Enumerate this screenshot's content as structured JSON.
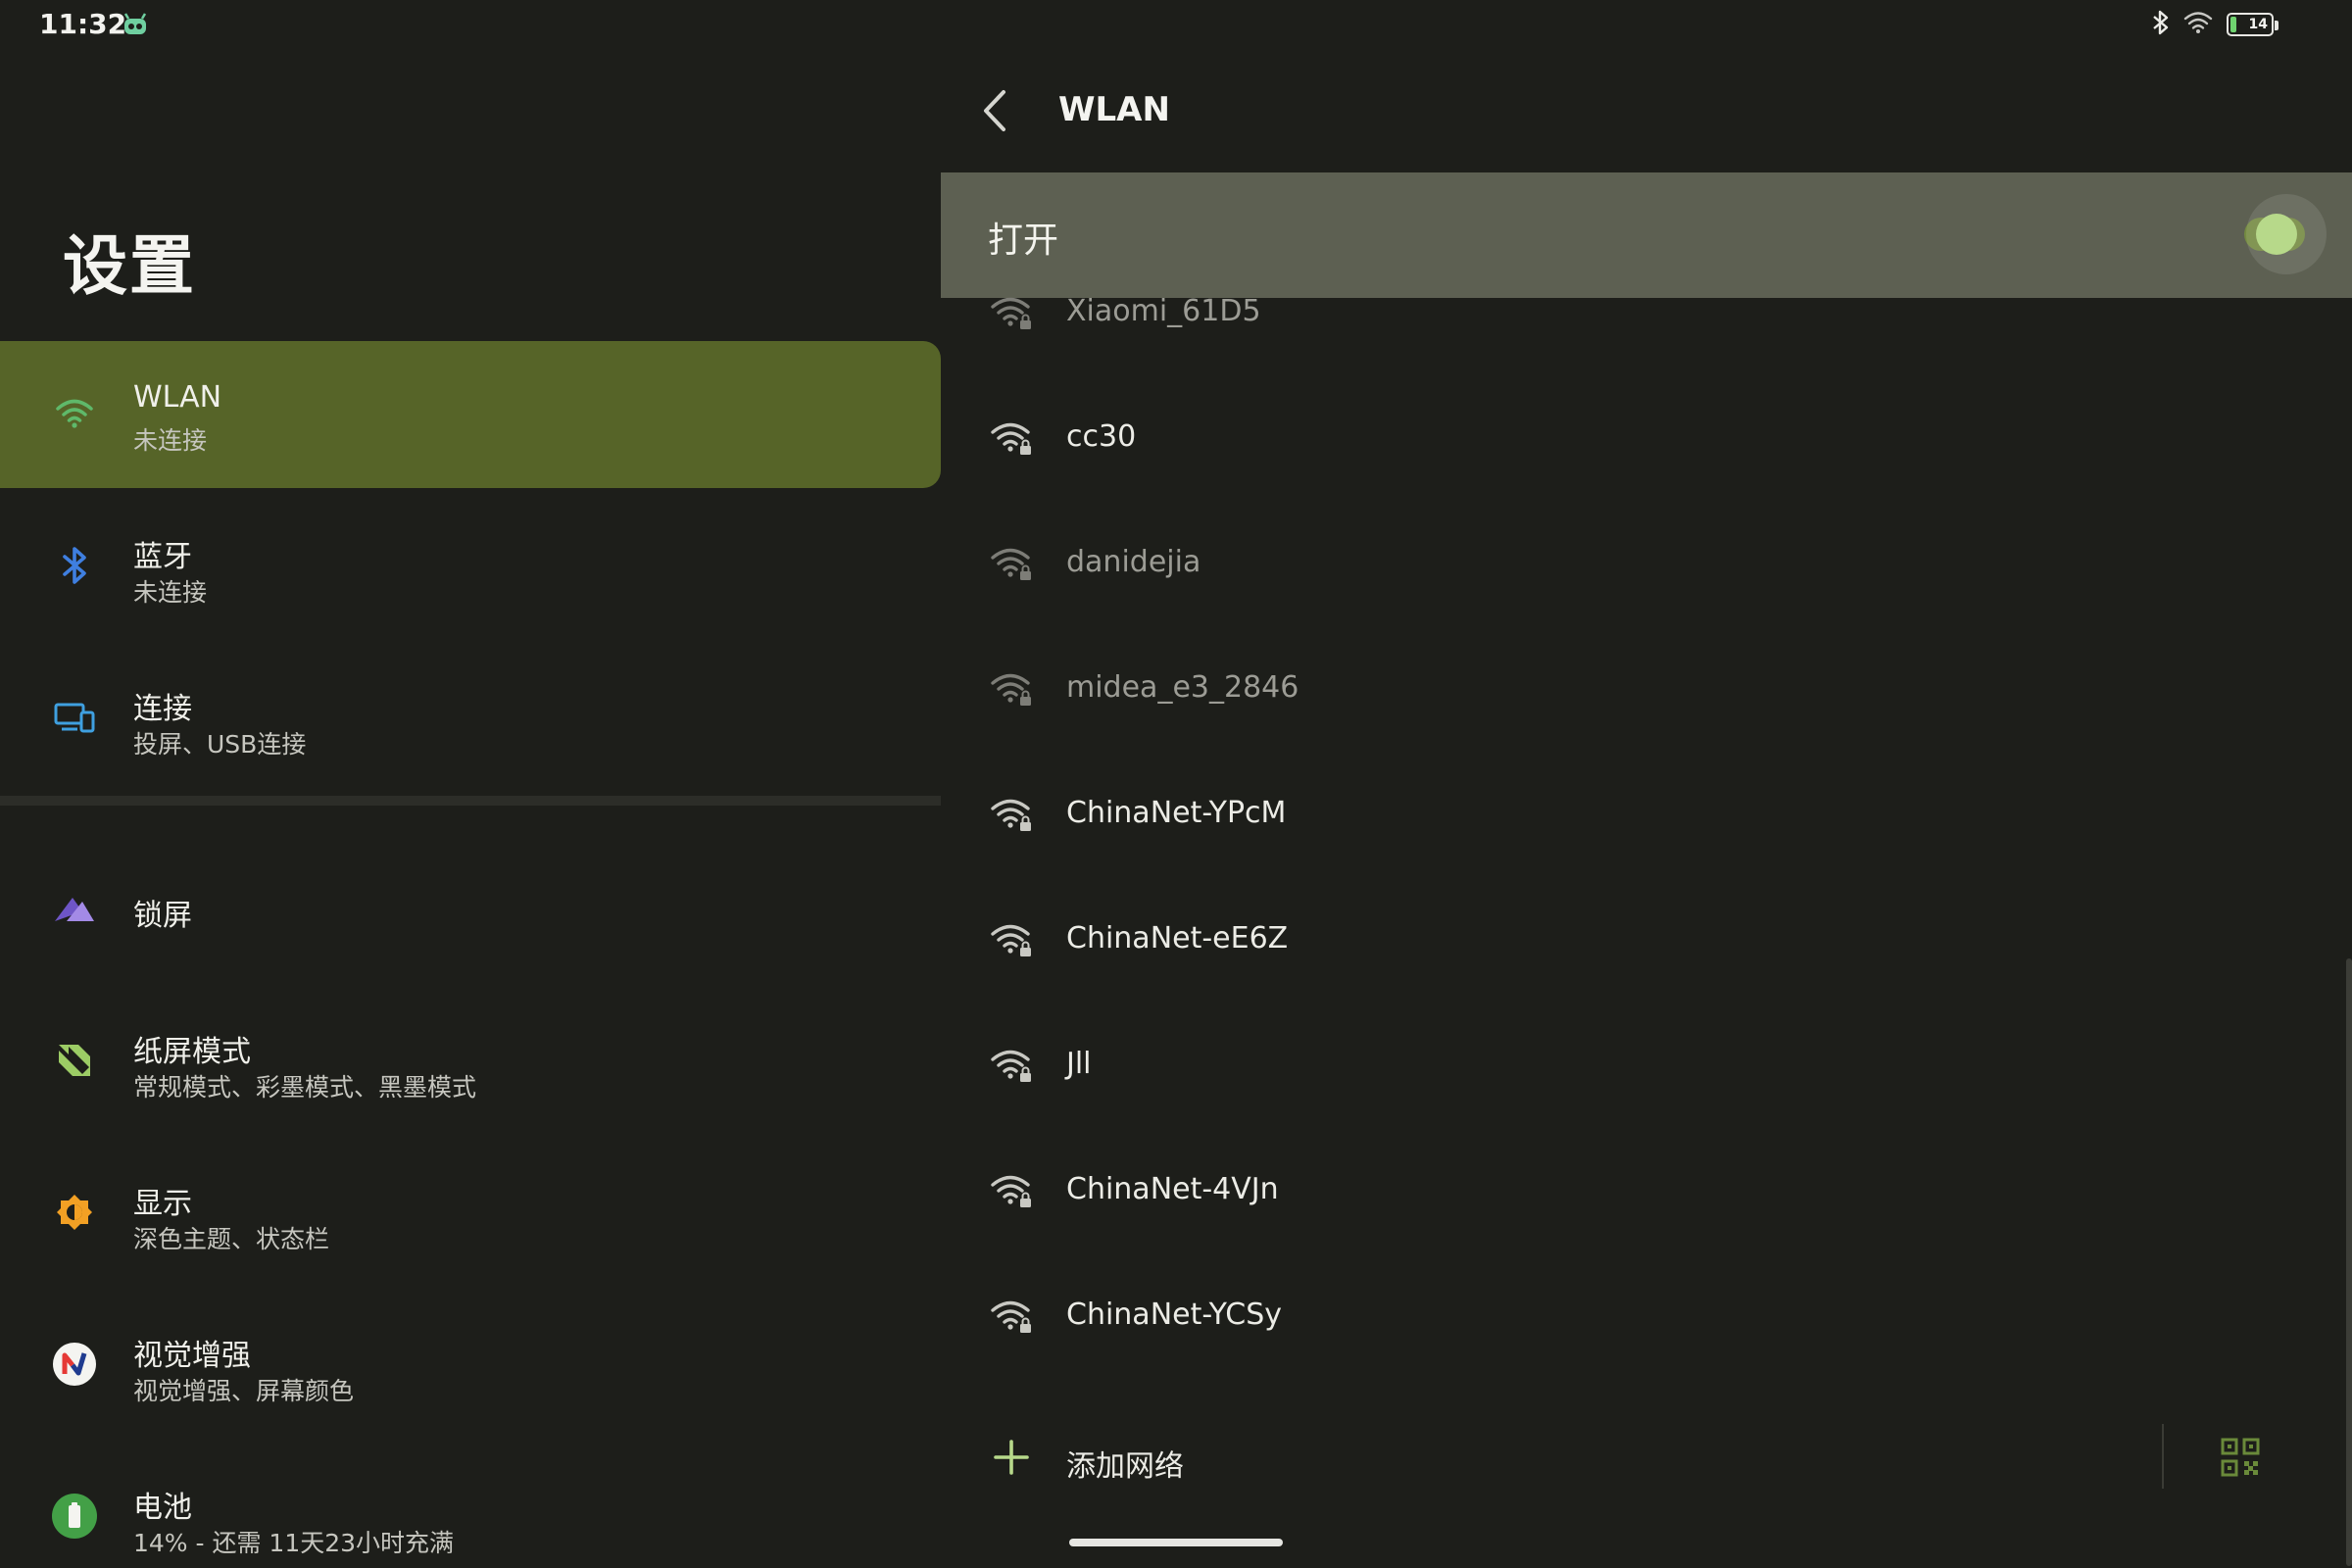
{
  "status_bar": {
    "time": "11:32",
    "battery_level": "14",
    "battery_fraction": 0.14,
    "icons": [
      "robot-icon",
      "bluetooth-icon",
      "wifi-icon",
      "battery-charging-icon"
    ]
  },
  "settings": {
    "title": "设置",
    "items": [
      {
        "title": "WLAN",
        "subtitle": "未连接",
        "icon": "wifi-icon",
        "color": "#5fb96a",
        "selected": true
      },
      {
        "title": "蓝牙",
        "subtitle": "未连接",
        "icon": "bluetooth-icon",
        "color": "#3f7fe0"
      },
      {
        "title": "连接",
        "subtitle": "投屏、USB连接",
        "icon": "devices-icon",
        "color": "#3fa0e0"
      },
      {
        "title": "锁屏",
        "subtitle": "",
        "icon": "lockscreen-icon",
        "color": "#8b6fd6"
      },
      {
        "title": "纸屏模式",
        "subtitle": "常规模式、彩墨模式、黑墨模式",
        "icon": "paper-mode-icon",
        "color": "#9ccc65"
      },
      {
        "title": "显示",
        "subtitle": "深色主题、状态栏",
        "icon": "display-icon",
        "color": "#f2a024"
      },
      {
        "title": "视觉增强",
        "subtitle": "视觉增强、屏幕颜色",
        "icon": "visual-enhance-icon",
        "color": "#e53935"
      },
      {
        "title": "电池",
        "subtitle": "14% - 还需 11天23小时充满",
        "icon": "battery-icon",
        "color": "#43a047"
      }
    ]
  },
  "wlan": {
    "title": "WLAN",
    "toggle_label": "打开",
    "toggle_on": true,
    "networks": [
      {
        "name": "Xiaomi_61D5",
        "dim": true
      },
      {
        "name": "cc30",
        "dim": false
      },
      {
        "name": "danidejia",
        "dim": true
      },
      {
        "name": "midea_e3_2846",
        "dim": true
      },
      {
        "name": "ChinaNet-YPcM",
        "dim": false
      },
      {
        "name": "ChinaNet-eE6Z",
        "dim": false
      },
      {
        "name": "Jll",
        "dim": false
      },
      {
        "name": "ChinaNet-4VJn",
        "dim": false
      },
      {
        "name": "ChinaNet-YCSy",
        "dim": false
      }
    ],
    "add_network_label": "添加网络"
  },
  "colors": {
    "background": "#1d1e1a",
    "selected_item": "#566428",
    "toggle_row": "#5d6052",
    "toggle_track": "#748a41",
    "toggle_knob": "#b7d98a"
  }
}
